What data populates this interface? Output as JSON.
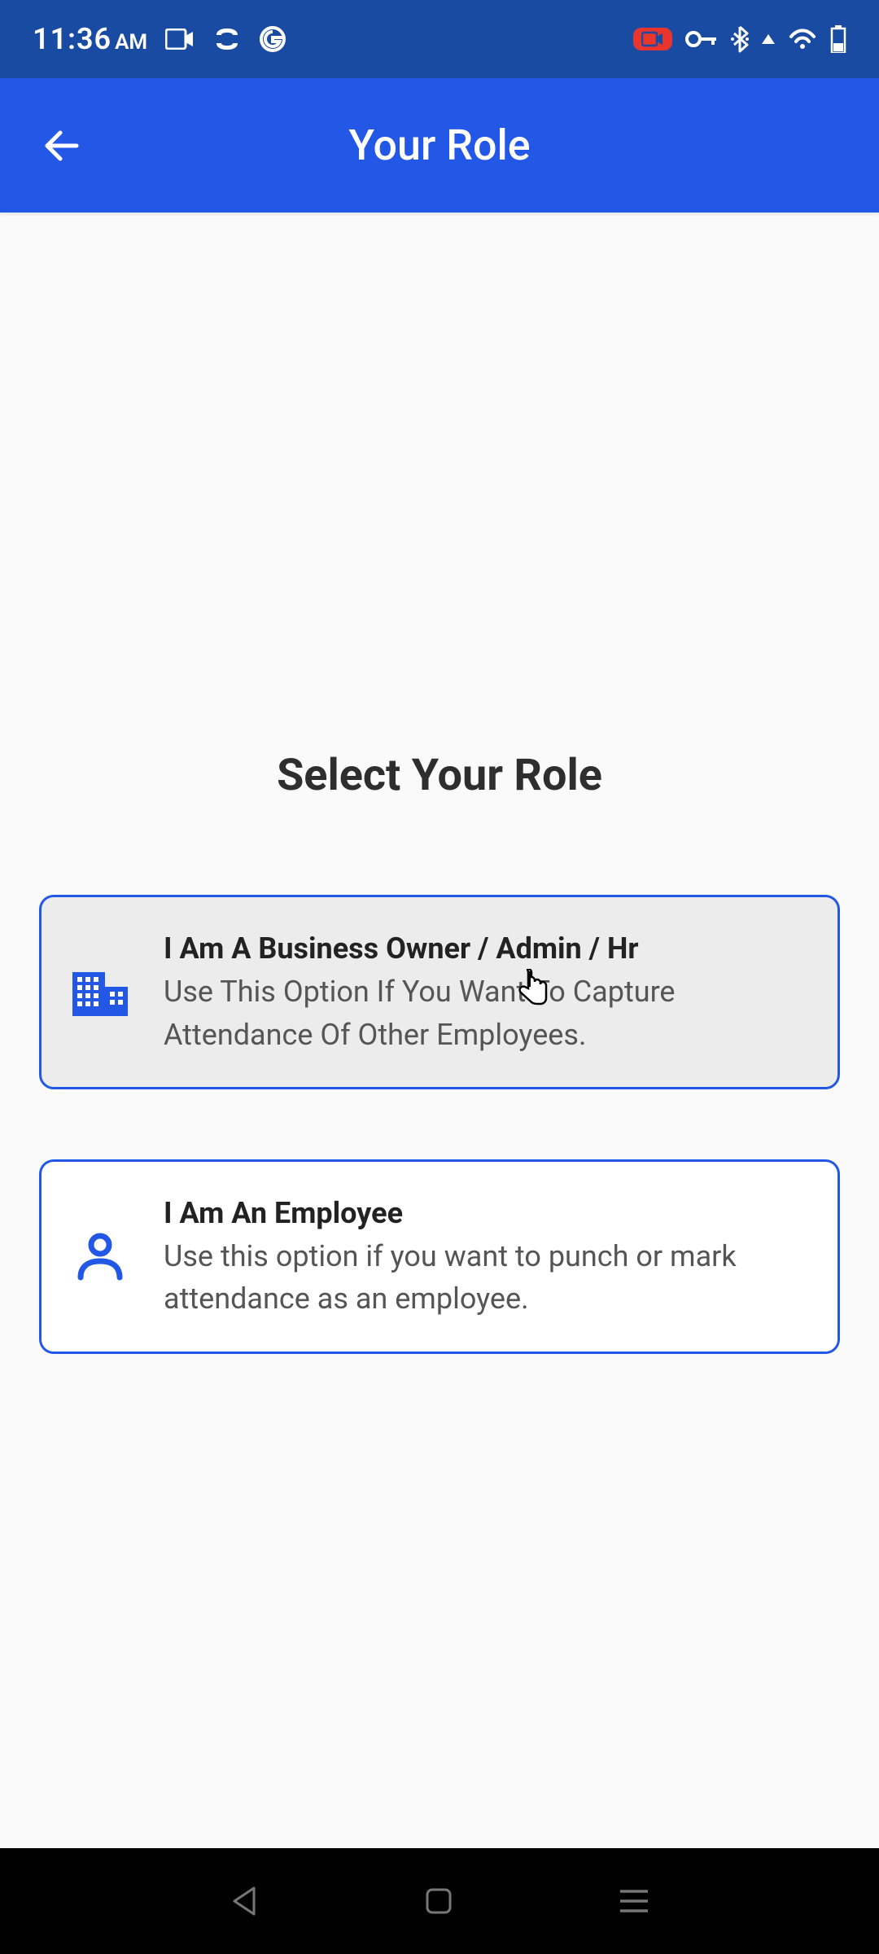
{
  "status_bar": {
    "time": "11:36",
    "time_suffix": "AM"
  },
  "app_bar": {
    "title": "Your Role"
  },
  "main": {
    "heading": "Select Your Role",
    "options": [
      {
        "title": "I Am A Business Owner / Admin / Hr",
        "subtitle": "Use This Option If You Want To Capture Attendance Of Other Employees.",
        "selected": true
      },
      {
        "title": "I Am An Employee",
        "subtitle": "Use this option if you want to punch or mark attendance as an employee.",
        "selected": false
      }
    ]
  }
}
